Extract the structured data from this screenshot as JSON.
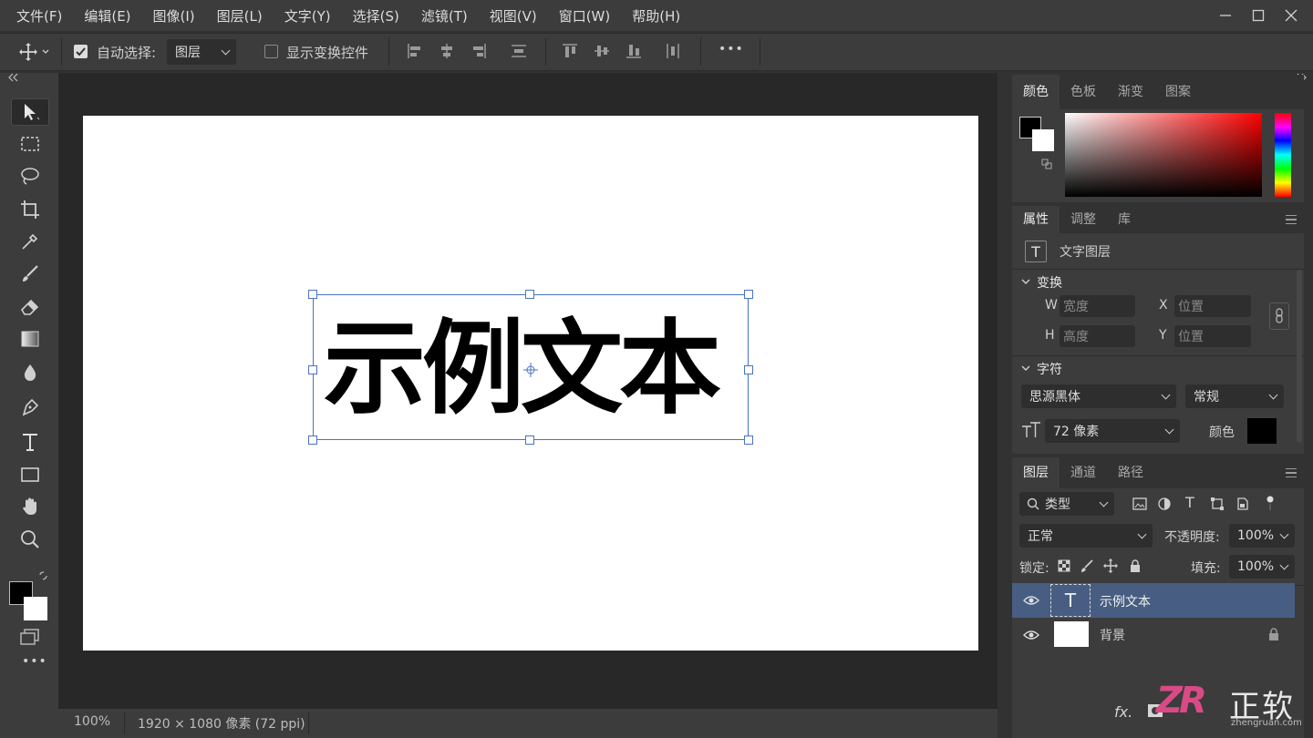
{
  "menu": [
    "文件(F)",
    "编辑(E)",
    "图像(I)",
    "图层(L)",
    "文字(Y)",
    "选择(S)",
    "滤镜(T)",
    "视图(V)",
    "窗口(W)",
    "帮助(H)"
  ],
  "options": {
    "auto_select_label": "自动选择:",
    "auto_select_value": "图层",
    "show_transform_label": "显示变换控件",
    "more": "•••"
  },
  "canvas": {
    "text": "示例文本"
  },
  "status": {
    "zoom": "100%",
    "doc_size": "1920 × 1080 像素 (72 ppi)"
  },
  "color_panel": {
    "tabs": [
      "颜色",
      "色板",
      "渐变",
      "图案"
    ]
  },
  "properties": {
    "tabs": [
      "属性",
      "调整",
      "库"
    ],
    "layer_type": "文字图层",
    "transform_label": "变换",
    "w_label": "W",
    "width_placeholder": "宽度",
    "x_label": "X",
    "x_placeholder": "位置",
    "h_label": "H",
    "height_placeholder": "高度",
    "y_label": "Y",
    "y_placeholder": "位置",
    "char_label": "字符",
    "font_family": "思源黑体",
    "font_style": "常规",
    "font_size": "72 像素",
    "color_label": "颜色"
  },
  "layers": {
    "tabs": [
      "图层",
      "通道",
      "路径"
    ],
    "filter_kind": "类型",
    "blend_mode": "正常",
    "opacity_label": "不透明度:",
    "opacity": "100%",
    "lock_label": "锁定:",
    "fill_label": "填充:",
    "fill": "100%",
    "items": [
      {
        "name": "示例文本",
        "thumb": "T"
      },
      {
        "name": "背景"
      }
    ],
    "fx": "fx."
  },
  "watermark": {
    "logo": "ZR",
    "name": "正软",
    "url": "zhengruan.com"
  },
  "colors": {
    "accent": "#4a72c4",
    "selected_layer": "#475e82"
  }
}
